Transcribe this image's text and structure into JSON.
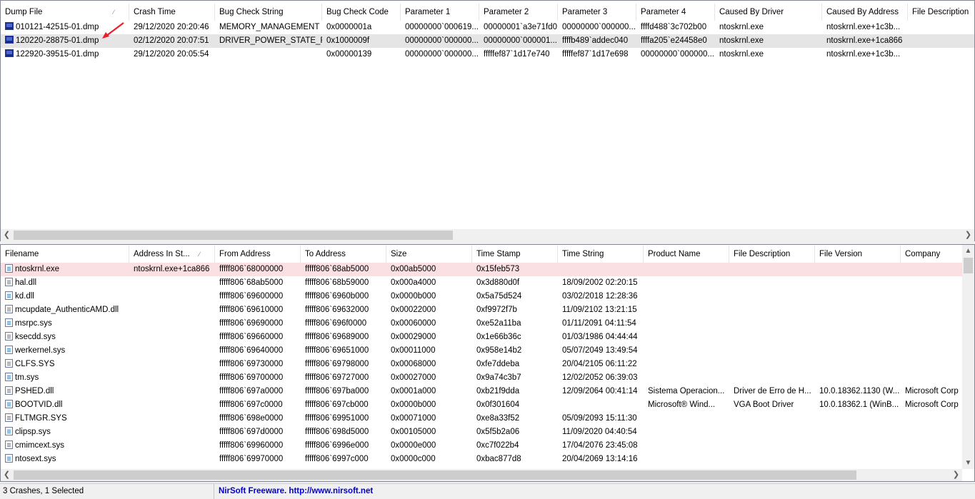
{
  "top": {
    "columns": [
      "Dump File",
      "Crash Time",
      "Bug Check String",
      "Bug Check Code",
      "Parameter 1",
      "Parameter 2",
      "Parameter 3",
      "Parameter 4",
      "Caused By Driver",
      "Caused By Address",
      "File Description"
    ],
    "rows": [
      [
        "010121-42515-01.dmp",
        "29/12/2020 20:20:46",
        "MEMORY_MANAGEMENT",
        "0x0000001a",
        "00000000`000619...",
        "00000001`a3e71fd0",
        "00000000`000000...",
        "ffffd488`3c702b00",
        "ntoskrnl.exe",
        "ntoskrnl.exe+1c3b...",
        ""
      ],
      [
        "120220-28875-01.dmp",
        "02/12/2020 20:07:51",
        "DRIVER_POWER_STATE_F...",
        "0x1000009f",
        "00000000`000000...",
        "00000000`000001...",
        "ffffb489`addec040",
        "ffffa205`e24458e0",
        "ntoskrnl.exe",
        "ntoskrnl.exe+1ca866",
        ""
      ],
      [
        "122920-39515-01.dmp",
        "29/12/2020 20:05:54",
        "",
        "0x00000139",
        "00000000`000000...",
        "fffffef87`1d17e740",
        "fffffef87`1d17e698",
        "00000000`000000...",
        "ntoskrnl.exe",
        "ntoskrnl.exe+1c3b...",
        ""
      ]
    ]
  },
  "bottom": {
    "columns": [
      "Filename",
      "Address In St...",
      "From Address",
      "To Address",
      "Size",
      "Time Stamp",
      "Time String",
      "Product Name",
      "File Description",
      "File Version",
      "Company"
    ],
    "rows": [
      [
        "ntoskrnl.exe",
        "ntoskrnl.exe+1ca866",
        "fffff806`68000000",
        "fffff806`68ab5000",
        "0x00ab5000",
        "0x15feb573",
        "",
        "",
        "",
        "",
        ""
      ],
      [
        "hal.dll",
        "",
        "fffff806`68ab5000",
        "fffff806`68b59000",
        "0x000a4000",
        "0x3d880d0f",
        "18/09/2002 02:20:15",
        "",
        "",
        "",
        ""
      ],
      [
        "kd.dll",
        "",
        "fffff806`69600000",
        "fffff806`6960b000",
        "0x0000b000",
        "0x5a75d524",
        "03/02/2018 12:28:36",
        "",
        "",
        "",
        ""
      ],
      [
        "mcupdate_AuthenticAMD.dll",
        "",
        "fffff806`69610000",
        "fffff806`69632000",
        "0x00022000",
        "0xf9972f7b",
        "11/09/2102 13:21:15",
        "",
        "",
        "",
        ""
      ],
      [
        "msrpc.sys",
        "",
        "fffff806`69690000",
        "fffff806`696f0000",
        "0x00060000",
        "0xe52a11ba",
        "01/11/2091 04:11:54",
        "",
        "",
        "",
        ""
      ],
      [
        "ksecdd.sys",
        "",
        "fffff806`69660000",
        "fffff806`69689000",
        "0x00029000",
        "0x1e66b36c",
        "01/03/1986 04:44:44",
        "",
        "",
        "",
        ""
      ],
      [
        "werkernel.sys",
        "",
        "fffff806`69640000",
        "fffff806`69651000",
        "0x00011000",
        "0x958e14b2",
        "05/07/2049 13:49:54",
        "",
        "",
        "",
        ""
      ],
      [
        "CLFS.SYS",
        "",
        "fffff806`69730000",
        "fffff806`69798000",
        "0x00068000",
        "0xfe7ddeba",
        "20/04/2105 06:11:22",
        "",
        "",
        "",
        ""
      ],
      [
        "tm.sys",
        "",
        "fffff806`69700000",
        "fffff806`69727000",
        "0x00027000",
        "0x9a74c3b7",
        "12/02/2052 06:39:03",
        "",
        "",
        "",
        ""
      ],
      [
        "PSHED.dll",
        "",
        "fffff806`697a0000",
        "fffff806`697ba000",
        "0x0001a000",
        "0xb21f9dda",
        "12/09/2064 00:41:14",
        "Sistema Operacion...",
        "Driver de Erro de H...",
        "10.0.18362.1130 (W...",
        "Microsoft Corp"
      ],
      [
        "BOOTVID.dll",
        "",
        "fffff806`697c0000",
        "fffff806`697cb000",
        "0x0000b000",
        "0x0f301604",
        "",
        "Microsoft® Wind...",
        "VGA Boot Driver",
        "10.0.18362.1 (WinB...",
        "Microsoft Corp"
      ],
      [
        "FLTMGR.SYS",
        "",
        "fffff806`698e0000",
        "fffff806`69951000",
        "0x00071000",
        "0xe8a33f52",
        "05/09/2093 15:11:30",
        "",
        "",
        "",
        ""
      ],
      [
        "clipsp.sys",
        "",
        "fffff806`697d0000",
        "fffff806`698d5000",
        "0x00105000",
        "0x5f5b2a06",
        "11/09/2020 04:40:54",
        "",
        "",
        "",
        ""
      ],
      [
        "cmimcext.sys",
        "",
        "fffff806`69960000",
        "fffff806`6996e000",
        "0x0000e000",
        "0xc7f022b4",
        "17/04/2076 23:45:08",
        "",
        "",
        "",
        ""
      ],
      [
        "ntosext.sys",
        "",
        "fffff806`69970000",
        "fffff806`6997c000",
        "0x0000c000",
        "0xbac877d8",
        "20/04/2069 13:14:16",
        "",
        "",
        "",
        ""
      ]
    ]
  },
  "status": {
    "count": "3 Crashes, 1 Selected",
    "link_prefix": "NirSoft Freeware.  http://www.nirsoft.net"
  },
  "icons": {
    "dump_row": "dump-file-icon",
    "module_row": "file-icon",
    "annotation": "red-arrow-icon"
  },
  "colors": {
    "selected_row": "#e5e5e5",
    "highlight_row": "#fbe0e3",
    "link": "#0000cc",
    "arrow": "#e8202a"
  }
}
